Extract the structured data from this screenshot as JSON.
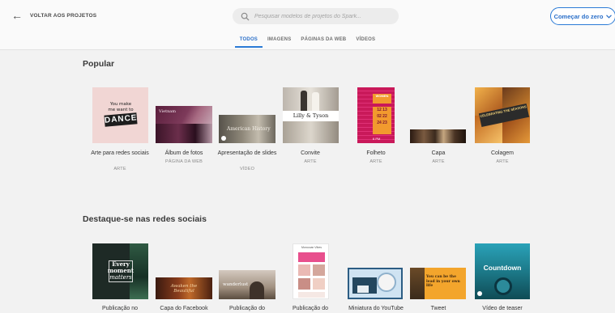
{
  "header": {
    "back_label": "VOLTAR AOS PROJETOS",
    "search_placeholder": "Pesquisar modelos de projetos do Spark...",
    "start_button": "Começar do zero"
  },
  "tabs": [
    {
      "label": "TODOS",
      "active": true
    },
    {
      "label": "IMAGENS",
      "active": false
    },
    {
      "label": "PÁGINAS DA WEB",
      "active": false
    },
    {
      "label": "VÍDEOS",
      "active": false
    }
  ],
  "sections": [
    {
      "title": "Popular",
      "items": [
        {
          "label": "Arte para redes sociais",
          "type": "ARTE",
          "thumb_text": "You make me want to DANCE"
        },
        {
          "label": "Álbum de fotos",
          "type": "PÁGINA DA WEB",
          "thumb_text": "Vietnam"
        },
        {
          "label": "Apresentação de slides",
          "type": "VÍDEO",
          "thumb_text": "American History"
        },
        {
          "label": "Convite",
          "type": "ARTE",
          "thumb_text": "Lilly & Tyson"
        },
        {
          "label": "Folheto",
          "type": "ARTE",
          "thumb_text": "WOMEN 12 13 02 22 24 23 6 PM"
        },
        {
          "label": "Capa",
          "type": "ARTE",
          "thumb_text": ""
        },
        {
          "label": "Colagem",
          "type": "ARTE",
          "thumb_text": "CELEBRATING THE SEASONS"
        }
      ]
    },
    {
      "title": "Destaque-se nas redes sociais",
      "items": [
        {
          "label": "Publicação no",
          "thumb_text": "Every moment matters"
        },
        {
          "label": "Capa do Facebook",
          "thumb_text": "Awaken the Beautiful"
        },
        {
          "label": "Publicação do",
          "thumb_text": "wanderlust"
        },
        {
          "label": "Publicação do",
          "thumb_text": "Moroccan Vibes"
        },
        {
          "label": "Miniatura do YouTube",
          "thumb_text": ""
        },
        {
          "label": "Tweet",
          "thumb_text": "You can be the lead in your own life"
        },
        {
          "label": "Vídeo de teaser",
          "thumb_text": "Countdown"
        }
      ]
    }
  ],
  "colors": {
    "accent": "#2a7ad6",
    "background": "#f2f2f2"
  }
}
